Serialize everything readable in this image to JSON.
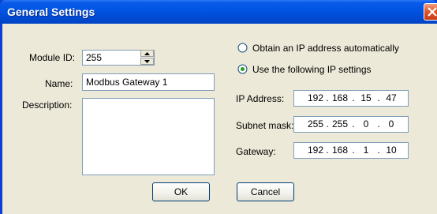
{
  "window": {
    "title": "General Settings",
    "close_icon": "close-icon"
  },
  "left": {
    "module_id_label": "Module ID:",
    "module_id_value": "255",
    "name_label": "Name:",
    "name_value": "Modbus Gateway 1",
    "description_label": "Description:",
    "description_value": ""
  },
  "ip_mode": {
    "auto_label": "Obtain an IP address automatically",
    "manual_label": "Use the following IP settings",
    "selected": "manual"
  },
  "ip_settings": {
    "ip_label": "IP Address:",
    "ip": [
      "192",
      "168",
      "15",
      "47"
    ],
    "subnet_label": "Subnet mask:",
    "subnet": [
      "255",
      "255",
      "0",
      "0"
    ],
    "gateway_label": "Gateway:",
    "gateway": [
      "192",
      "168",
      "1",
      "10"
    ]
  },
  "buttons": {
    "ok": "OK",
    "cancel": "Cancel"
  }
}
